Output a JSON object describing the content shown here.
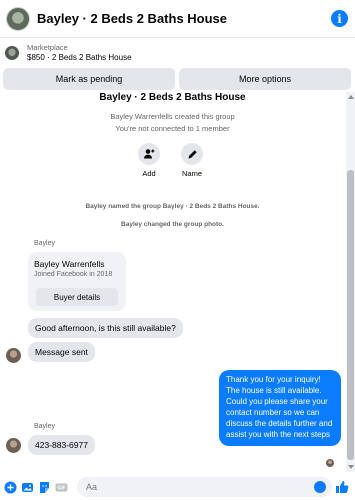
{
  "header": {
    "title": "Bayley · 2 Beds 2 Baths House"
  },
  "marketplace": {
    "label": "Marketplace",
    "listing": "$850 · 2 Beds 2 Baths House"
  },
  "actions": {
    "pending": "Mark as pending",
    "more": "More options"
  },
  "group": {
    "title": "Bayley · 2 Beds 2 Baths House",
    "created": "Bayley Warrenfells created this group",
    "connected": "You're not connected to 1 member",
    "add_label": "Add",
    "name_label": "Name"
  },
  "system": {
    "named": "Bayley named the group Bayley · 2 Beds 2 Baths House.",
    "photo": "Bayley changed the group photo."
  },
  "messages": {
    "sender1": "Bayley",
    "card_name": "Bayley Warrenfells",
    "card_joined": "Joined Facebook in 2018",
    "card_button": "Buyer details",
    "msg1": "Good afternoon, is this still available?",
    "msg2": "Message sent",
    "reply": "Thank you for your inquiry! The house is still available. Could you please share your contact number so we can discuss the details further and assist you with the next steps",
    "sender2": "Bayley",
    "msg3": "423-883-6977"
  },
  "composer": {
    "placeholder": "Aa"
  },
  "colors": {
    "accent": "#0a7cff",
    "bubble_in": "#e4e6eb",
    "muted": "#65676b"
  }
}
